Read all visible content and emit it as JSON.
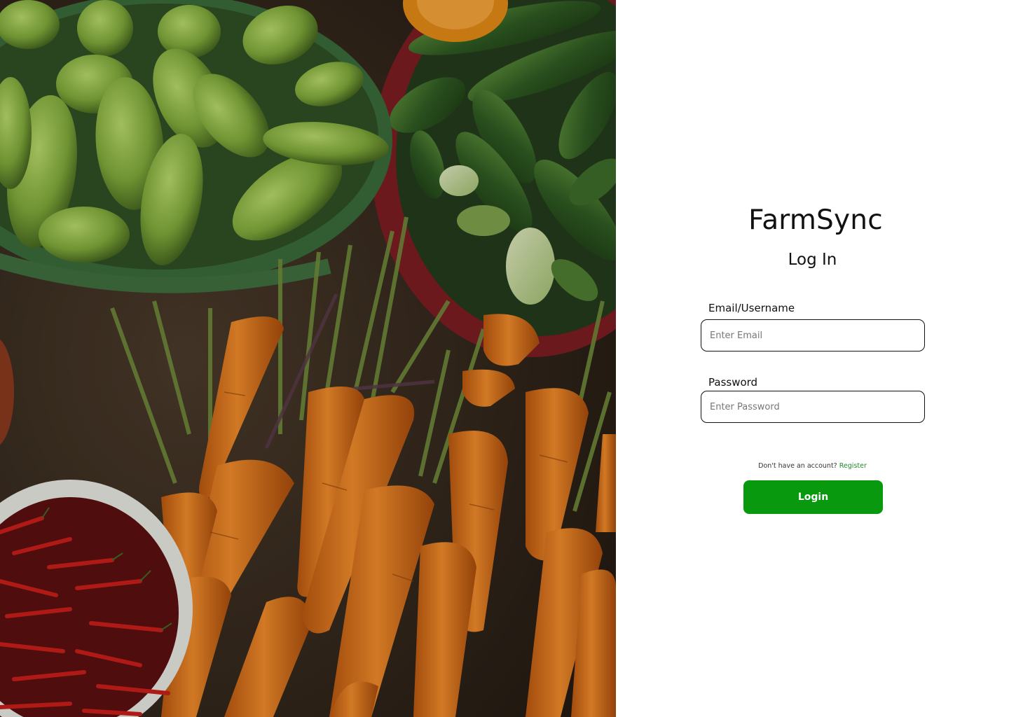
{
  "brand": {
    "name": "FarmSync"
  },
  "login": {
    "heading": "Log In",
    "email": {
      "label": "Email/Username",
      "placeholder": "Enter Email",
      "value": ""
    },
    "password": {
      "label": "Password",
      "placeholder": "Enter Password",
      "value": ""
    },
    "signup_prompt": "Don't have an account?",
    "signup_link": "Register",
    "submit_label": "Login"
  },
  "colors": {
    "accent": "#08990f",
    "link": "#1f8a2e"
  },
  "hero_image": {
    "subject": "vegetables-photo"
  }
}
